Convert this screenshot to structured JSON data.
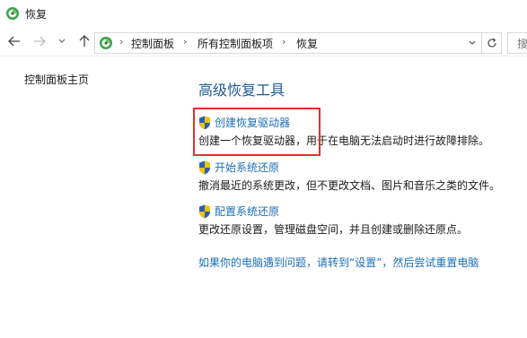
{
  "window": {
    "title": "恢复"
  },
  "addressbar": {
    "breadcrumbs": [
      "控制面板",
      "所有控制面板项",
      "恢复"
    ]
  },
  "search": {
    "placeholder": "搜"
  },
  "sidebar": {
    "home_label": "控制面板主页"
  },
  "main": {
    "heading": "高级恢复工具",
    "items": [
      {
        "link": "创建恢复驱动器",
        "description": "创建一个恢复驱动器，用于在电脑无法启动时进行故障排除。"
      },
      {
        "link": "开始系统还原",
        "description": "撤消最近的系统更改，但不更改文档、图片和音乐之类的文件。"
      },
      {
        "link": "配置系统还原",
        "description": "更改还原设置，管理磁盘空间，并且创建或删除还原点。"
      }
    ],
    "reset_link": "如果你的电脑遇到问题，请转到“设置”，然后尝试重置电脑"
  },
  "colors": {
    "link": "#1a6fb5",
    "heading": "#1e5a92",
    "highlight": "#e03030",
    "shield_blue": "#2b5fb4",
    "shield_yellow": "#f2c200"
  },
  "icons": [
    "recovery-icon",
    "back-arrow-icon",
    "forward-arrow-icon",
    "chevron-down-icon",
    "up-arrow-icon",
    "refresh-icon",
    "uac-shield-icon"
  ]
}
